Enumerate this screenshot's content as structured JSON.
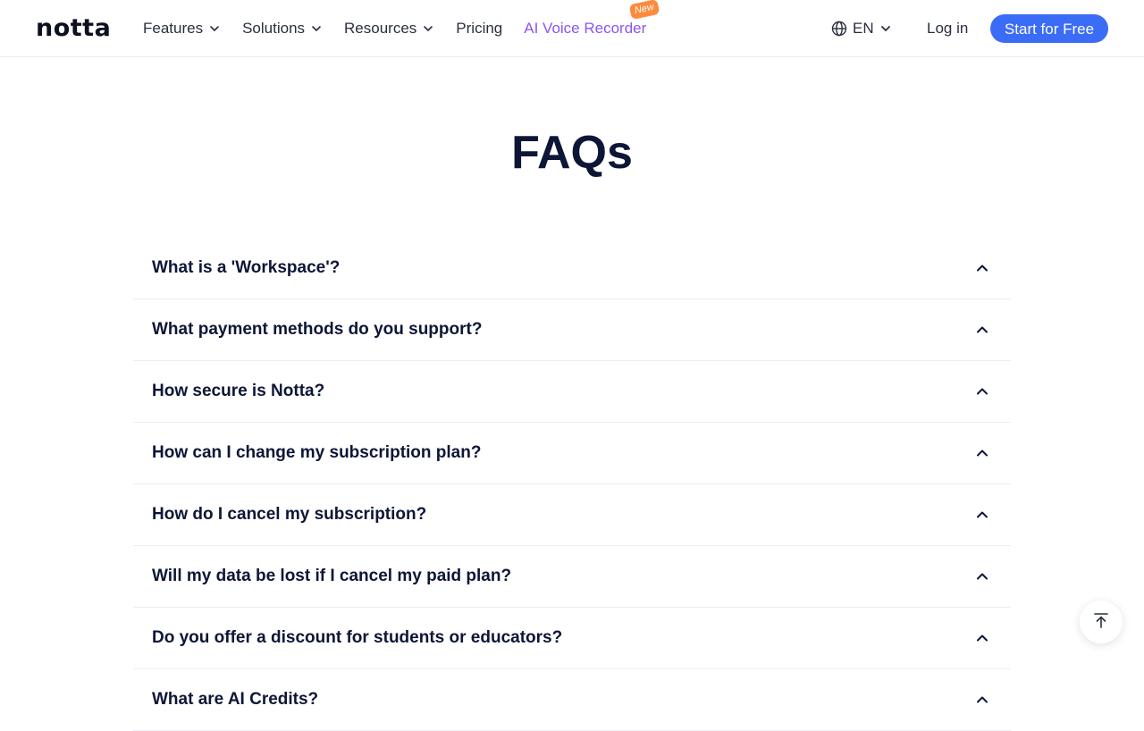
{
  "header": {
    "logo": "notta",
    "nav": [
      {
        "label": "Features",
        "has_dropdown": true
      },
      {
        "label": "Solutions",
        "has_dropdown": true
      },
      {
        "label": "Resources",
        "has_dropdown": true
      },
      {
        "label": "Pricing",
        "has_dropdown": false
      }
    ],
    "ai_recorder": {
      "label": "AI Voice Recorder",
      "badge": "New"
    },
    "language": "EN",
    "login": "Log in",
    "cta": "Start for Free"
  },
  "colors": {
    "primary": "#3b6cf6",
    "ai_recorder": "#8a55f5",
    "badge": "#ff8a3d",
    "heading": "#0d1636"
  },
  "faq": {
    "title": "FAQs",
    "questions": [
      "What is a 'Workspace'?",
      "What payment methods do you support?",
      "How secure is Notta?",
      "How can I change my subscription plan?",
      "How do I cancel my subscription?",
      "Will my data be lost if I cancel my paid plan?",
      "Do you offer a discount for students or educators?",
      "What are AI Credits?"
    ]
  },
  "icons": {
    "globe": "globe-icon",
    "chevron": "chevron-down-icon",
    "faq_toggle": "chevron-up-icon",
    "back_to_top": "arrow-up-to-line-icon"
  }
}
